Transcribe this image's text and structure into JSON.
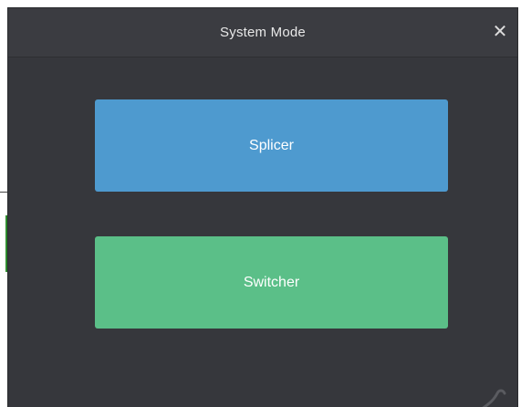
{
  "dialog": {
    "title": "System Mode",
    "close_icon": "close-icon",
    "close_glyph": "✕"
  },
  "modes": {
    "splicer_label": "Splicer",
    "switcher_label": "Switcher"
  },
  "colors": {
    "dialog_bg": "#36373c",
    "splicer": "#4e9acf",
    "switcher": "#5bbf88"
  }
}
